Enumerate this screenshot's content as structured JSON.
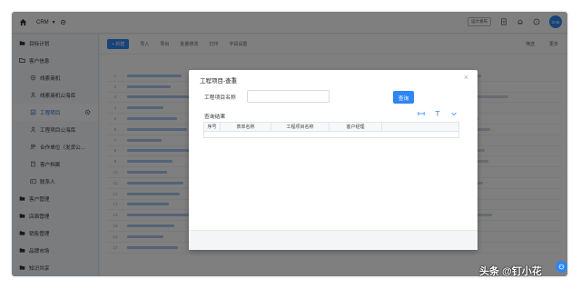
{
  "topbar": {
    "app_name": "CRM",
    "design_tag": "设计发布",
    "avatar_text": "ZHB"
  },
  "sidebar": {
    "items": [
      {
        "label": "目标计划",
        "level": 1
      },
      {
        "label": "客户信息",
        "level": 1
      },
      {
        "label": "线索商机",
        "level": 2
      },
      {
        "label": "线索商机公海库",
        "level": 2
      },
      {
        "label": "工程项目",
        "level": 2,
        "active": true
      },
      {
        "label": "工程项目公海库",
        "level": 2
      },
      {
        "label": "合作单位（发货公...",
        "level": 2
      },
      {
        "label": "客户档案",
        "level": 2
      },
      {
        "label": "联系人",
        "level": 2
      },
      {
        "label": "客户管理",
        "level": 1
      },
      {
        "label": "店面管理",
        "level": 1
      },
      {
        "label": "销售管理",
        "level": 1
      },
      {
        "label": "品牌市场",
        "level": 1
      },
      {
        "label": "知识共享",
        "level": 1
      }
    ]
  },
  "main": {
    "toolbar": {
      "new_label": "+ 新建",
      "import_label": "导入",
      "export_label": "导出",
      "bulk_label": "批量修改",
      "print_label": "打印",
      "fields_label": "字段设置",
      "filter_label": "筛选",
      "more_label": "更多"
    },
    "row_numbers": [
      "1",
      "2",
      "3",
      "4",
      "5",
      "6",
      "7",
      "8",
      "9",
      "10",
      "11",
      "12",
      "13",
      "14",
      "15",
      "16",
      "17"
    ]
  },
  "modal": {
    "title": "工程项目-查重",
    "field_label": "工程项目名称",
    "field_value": "",
    "query_button": "查询",
    "result_label": "查询结果",
    "columns": [
      "序号",
      "表单名称",
      "工程项目名称",
      "客户经理"
    ]
  },
  "fab_text": "",
  "watermark": "头条 @钉小花",
  "colors": {
    "accent": "#2e86f5",
    "active_text": "#1f6fe0"
  }
}
